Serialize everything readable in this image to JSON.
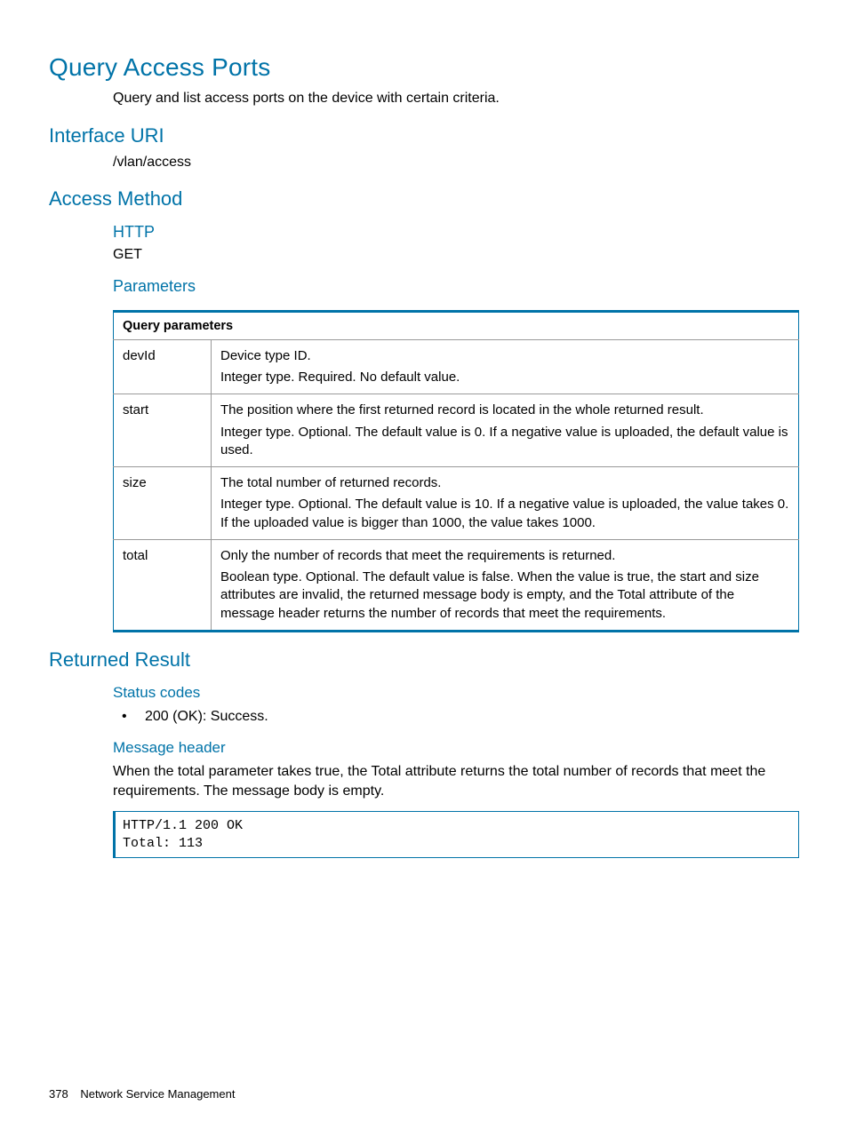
{
  "title": "Query Access Ports",
  "intro": "Query and list access ports on the device with certain criteria.",
  "interface_uri": {
    "heading": "Interface URI",
    "value": "/vlan/access"
  },
  "access_method": {
    "heading": "Access Method",
    "http": {
      "label": "HTTP",
      "method": "GET"
    },
    "parameters": {
      "label": "Parameters",
      "table_title": "Query parameters",
      "rows": [
        {
          "name": "devId",
          "desc": [
            "Device type ID.",
            "Integer type. Required. No default value."
          ]
        },
        {
          "name": "start",
          "desc": [
            "The position where the first returned record is located in the whole returned result.",
            "Integer type. Optional. The default value is 0. If a negative value is uploaded, the default value is used."
          ]
        },
        {
          "name": "size",
          "desc": [
            "The total number of returned records.",
            "Integer type. Optional. The default value is 10. If a negative value is uploaded, the value takes 0. If the uploaded value is bigger than 1000, the value takes 1000."
          ]
        },
        {
          "name": "total",
          "desc": [
            "Only the number of records that meet the requirements is returned.",
            "Boolean type. Optional. The default value is false. When the value is true, the start and size attributes are invalid, the returned message body is empty, and the Total attribute of the message header returns the number of records that meet the requirements."
          ]
        }
      ]
    }
  },
  "returned_result": {
    "heading": "Returned Result",
    "status_codes": {
      "label": "Status codes",
      "items": [
        "200 (OK): Success."
      ]
    },
    "message_header": {
      "label": "Message header",
      "text": "When the total parameter takes true, the Total attribute returns the total number of records that meet the requirements. The message body is empty.",
      "code": "HTTP/1.1 200 OK\nTotal: 113"
    }
  },
  "footer": {
    "page": "378",
    "section": "Network Service Management"
  }
}
